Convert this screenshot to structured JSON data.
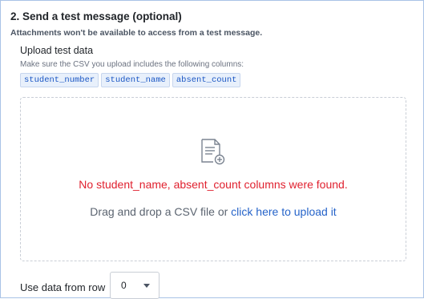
{
  "section": {
    "title": "2. Send a test message (optional)",
    "note": "Attachments won't be available to access from a test message."
  },
  "upload": {
    "label": "Upload test data",
    "hint": "Make sure the CSV you upload includes the following columns:",
    "columns": [
      "student_number",
      "student_name",
      "absent_count"
    ]
  },
  "dropzone": {
    "icon": "file-add-icon",
    "error": "No student_name, absent_count columns were found.",
    "drag_text": "Drag and drop a CSV file or ",
    "link_text": "click here to upload it"
  },
  "row_select": {
    "label": "Use data from row",
    "value": "0"
  },
  "colors": {
    "error": "#e0212f",
    "link": "#2563c9",
    "chip_text": "#1a56c4",
    "chip_bg": "#e8f0fb",
    "frame_border": "#a9c3e6"
  }
}
